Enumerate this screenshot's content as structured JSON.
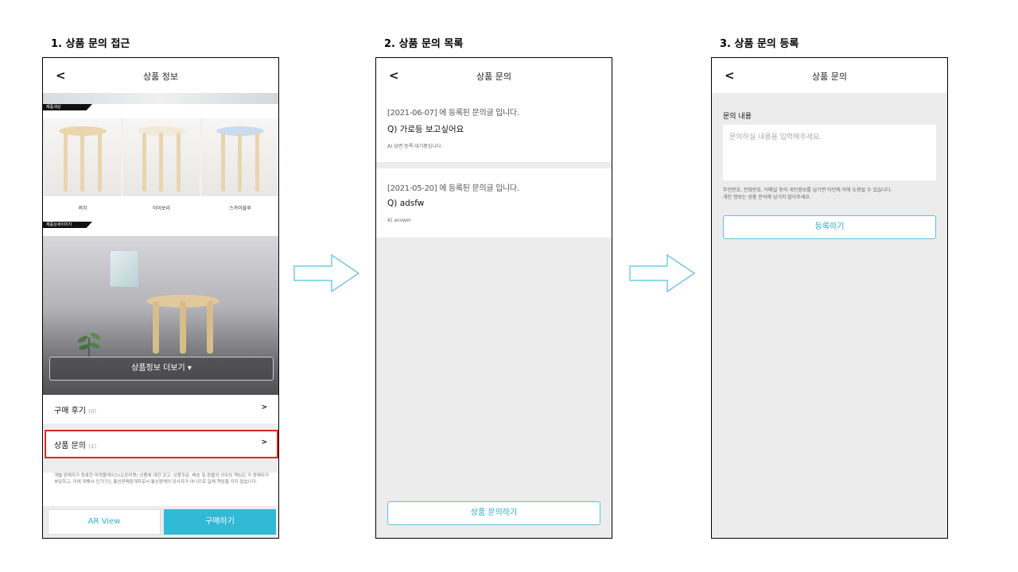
{
  "steps": [
    {
      "title": "1. 상품 문의 접근"
    },
    {
      "title": "2. 상품 문의 목록"
    },
    {
      "title": "3. 상품 문의 등록"
    }
  ],
  "screen1": {
    "header_title": "상품 정보",
    "color_tag": "제품색상",
    "colors": [
      {
        "label": "버치",
        "seat": "#ecd6ae"
      },
      {
        "label": "아이보리",
        "seat": "#f1ead8"
      },
      {
        "label": "스카이블루",
        "seat": "#c9dcf0"
      }
    ],
    "detail_tag": "제품상세이미지",
    "more_button": "상품정보 더보기 ▾",
    "reviews": {
      "label": "구매 후기",
      "count": "(0)",
      "chevron": ">"
    },
    "inquiries": {
      "label": "상품 문의",
      "count": "(1)",
      "chevron": ">"
    },
    "disclaimer": "개별 판매자가 등록한 마켓플레이스(오픈마켓) 상품에 대한 광고, 상품주문, 배송 및 환불의 의무와 책임은 각 판매자가 부담하고, 이에 대해서 인가구는 통신판매중개자로서 통신판매의 당사자가 아니므로 일체 책임을 지지 않습니다.",
    "ar_button": "AR View",
    "buy_button": "구매하기"
  },
  "screen2": {
    "header_title": "상품 문의",
    "questions": [
      {
        "date": "[2021-06-07] 에 등록된 문의글 입니다.",
        "question": "Q) 가로등 보고싶어요",
        "answer": "A) 답변 등록 대기중입니다."
      },
      {
        "date": "[2021-05-20] 에 등록된 문의글 입니다.",
        "question": "Q) adsfw",
        "answer": "A) answer"
      }
    ],
    "inquire_button": "상품 문의하기"
  },
  "screen3": {
    "header_title": "상품 문의",
    "field_label": "문의 내용",
    "placeholder": "문의하실 내용을 입력해주세요.",
    "notice_line1": "주민번호, 전화번호, 이메일 등의 개인정보를 남기면 타인에 의해 도용될 수 있습니다.",
    "notice_line2": "개인 정보는 상품 문의에 남기지 말아주세요.",
    "submit_button": "등록하기"
  },
  "colors": {
    "accent": "#31b9d6",
    "highlight": "#e52222",
    "arrow": "#4fbfdb"
  }
}
